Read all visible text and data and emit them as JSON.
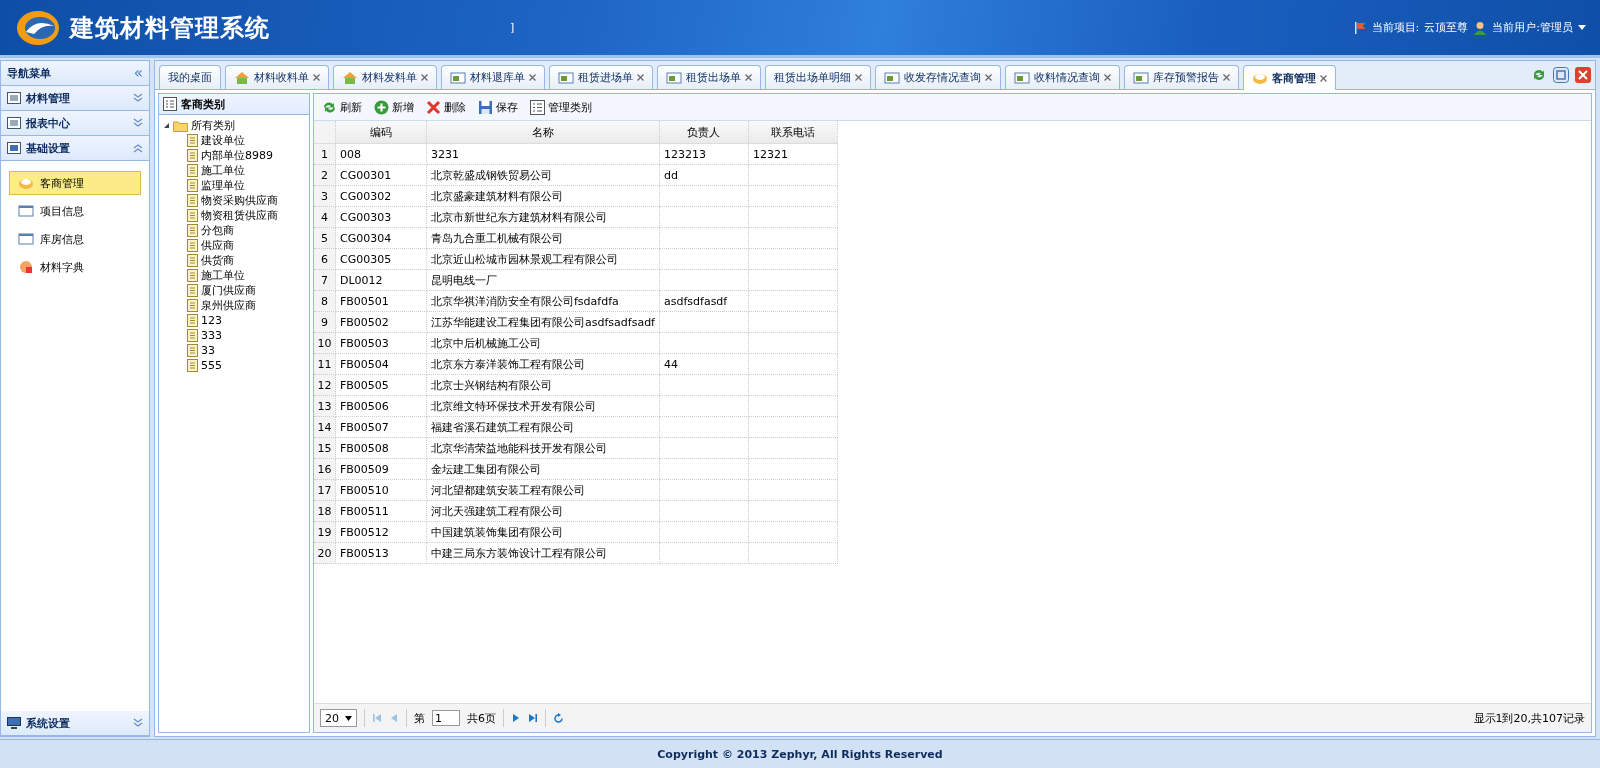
{
  "header": {
    "title": "建筑材料管理系统",
    "stray_text": "]",
    "project_label": "当前项目:",
    "project_value": "云顶至尊",
    "user_label": "当前用户:管理员"
  },
  "sidebar": {
    "title": "导航菜单",
    "collapse_glyph": "«",
    "sections": [
      {
        "label": "材料管理",
        "expanded": false
      },
      {
        "label": "报表中心",
        "expanded": false
      },
      {
        "label": "基础设置",
        "expanded": true,
        "items": [
          {
            "label": "客商管理",
            "selected": true
          },
          {
            "label": "项目信息",
            "selected": false
          },
          {
            "label": "库房信息",
            "selected": false
          },
          {
            "label": "材料字典",
            "selected": false
          }
        ]
      }
    ],
    "bottom_section": {
      "label": "系统设置",
      "expanded": false
    }
  },
  "tabs": [
    {
      "label": "我的桌面",
      "selected": false,
      "has_icon": false,
      "closable": false
    },
    {
      "label": "材料收料单",
      "selected": false,
      "has_icon": true,
      "closable": true
    },
    {
      "label": "材料发料单",
      "selected": false,
      "has_icon": true,
      "closable": true
    },
    {
      "label": "材料退库单",
      "selected": false,
      "has_icon": true,
      "closable": true
    },
    {
      "label": "租赁进场单",
      "selected": false,
      "has_icon": true,
      "closable": true
    },
    {
      "label": "租赁出场单",
      "selected": false,
      "has_icon": true,
      "closable": true
    },
    {
      "label": "租赁出场单明细",
      "selected": false,
      "has_icon": false,
      "closable": true
    },
    {
      "label": "收发存情况查询",
      "selected": false,
      "has_icon": true,
      "closable": true
    },
    {
      "label": "收料情况查询",
      "selected": false,
      "has_icon": true,
      "closable": true
    },
    {
      "label": "库存预警报告",
      "selected": false,
      "has_icon": true,
      "closable": true
    },
    {
      "label": "客商管理",
      "selected": true,
      "has_icon": true,
      "closable": true
    }
  ],
  "tree": {
    "title": "客商类别",
    "root": {
      "label": "所有类别",
      "expanded": true,
      "children": [
        {
          "label": "建设单位"
        },
        {
          "label": "内部单位8989"
        },
        {
          "label": "施工单位"
        },
        {
          "label": "监理单位"
        },
        {
          "label": "物资采购供应商"
        },
        {
          "label": "物资租赁供应商"
        },
        {
          "label": "分包商"
        },
        {
          "label": "供应商"
        },
        {
          "label": "供货商"
        },
        {
          "label": "施工单位"
        },
        {
          "label": "厦门供应商"
        },
        {
          "label": "泉州供应商"
        },
        {
          "label": "123"
        },
        {
          "label": "333"
        },
        {
          "label": "33"
        },
        {
          "label": "555"
        }
      ]
    }
  },
  "toolbar": [
    {
      "label": "刷新",
      "kind": "refresh"
    },
    {
      "label": "新增",
      "kind": "add"
    },
    {
      "label": "删除",
      "kind": "delete"
    },
    {
      "label": "保存",
      "kind": "save"
    },
    {
      "label": "管理类别",
      "kind": "manage"
    }
  ],
  "table": {
    "columns": [
      "编码",
      "名称",
      "负责人",
      "联系电话"
    ],
    "rows": [
      {
        "number": "1",
        "cells": [
          "008",
          "3231",
          "123213",
          "12321"
        ]
      },
      {
        "number": "2",
        "cells": [
          "CG00301",
          "北京乾盛成钢铁贸易公司",
          "dd",
          ""
        ]
      },
      {
        "number": "3",
        "cells": [
          "CG00302",
          "北京盛豪建筑材料有限公司",
          "",
          ""
        ]
      },
      {
        "number": "4",
        "cells": [
          "CG00303",
          "北京市新世纪东方建筑材料有限公司",
          "",
          ""
        ]
      },
      {
        "number": "5",
        "cells": [
          "CG00304",
          "青岛九合重工机械有限公司",
          "",
          ""
        ]
      },
      {
        "number": "6",
        "cells": [
          "CG00305",
          "北京近山松城市园林景观工程有限公司",
          "",
          ""
        ]
      },
      {
        "number": "7",
        "cells": [
          "DL0012",
          "昆明电线一厂",
          "",
          ""
        ]
      },
      {
        "number": "8",
        "cells": [
          "FB00501",
          "北京华祺洋消防安全有限公司fsdafdfa",
          "asdfsdfasdf",
          ""
        ]
      },
      {
        "number": "9",
        "cells": [
          "FB00502",
          "江苏华能建设工程集团有限公司asdfsadfsadf",
          "",
          ""
        ]
      },
      {
        "number": "10",
        "cells": [
          "FB00503",
          "北京中后机械施工公司",
          "",
          ""
        ]
      },
      {
        "number": "11",
        "cells": [
          "FB00504",
          "北京东方泰洋装饰工程有限公司",
          "44",
          ""
        ]
      },
      {
        "number": "12",
        "cells": [
          "FB00505",
          "北京士兴钢结构有限公司",
          "",
          ""
        ]
      },
      {
        "number": "13",
        "cells": [
          "FB00506",
          "北京维文特环保技术开发有限公司",
          "",
          ""
        ]
      },
      {
        "number": "14",
        "cells": [
          "FB00507",
          "福建省溪石建筑工程有限公司",
          "",
          ""
        ]
      },
      {
        "number": "15",
        "cells": [
          "FB00508",
          "北京华清荣益地能科技开发有限公司",
          "",
          ""
        ]
      },
      {
        "number": "16",
        "cells": [
          "FB00509",
          "金坛建工集团有限公司",
          "",
          ""
        ]
      },
      {
        "number": "17",
        "cells": [
          "FB00510",
          "河北望都建筑安装工程有限公司",
          "",
          ""
        ]
      },
      {
        "number": "18",
        "cells": [
          "FB00511",
          "河北天强建筑工程有限公司",
          "",
          ""
        ]
      },
      {
        "number": "19",
        "cells": [
          "FB00512",
          "中国建筑装饰集团有限公司",
          "",
          ""
        ]
      },
      {
        "number": "20",
        "cells": [
          "FB00513",
          "中建三局东方装饰设计工程有限公司",
          "",
          ""
        ]
      }
    ]
  },
  "pager": {
    "page_size": "20",
    "page_prefix": "第",
    "page": "1",
    "page_total": "共6页",
    "summary": "显示1到20,共107记录"
  },
  "footer": {
    "copyright": "Copyright © 2013 Zephyr, All Rights Reserved"
  }
}
